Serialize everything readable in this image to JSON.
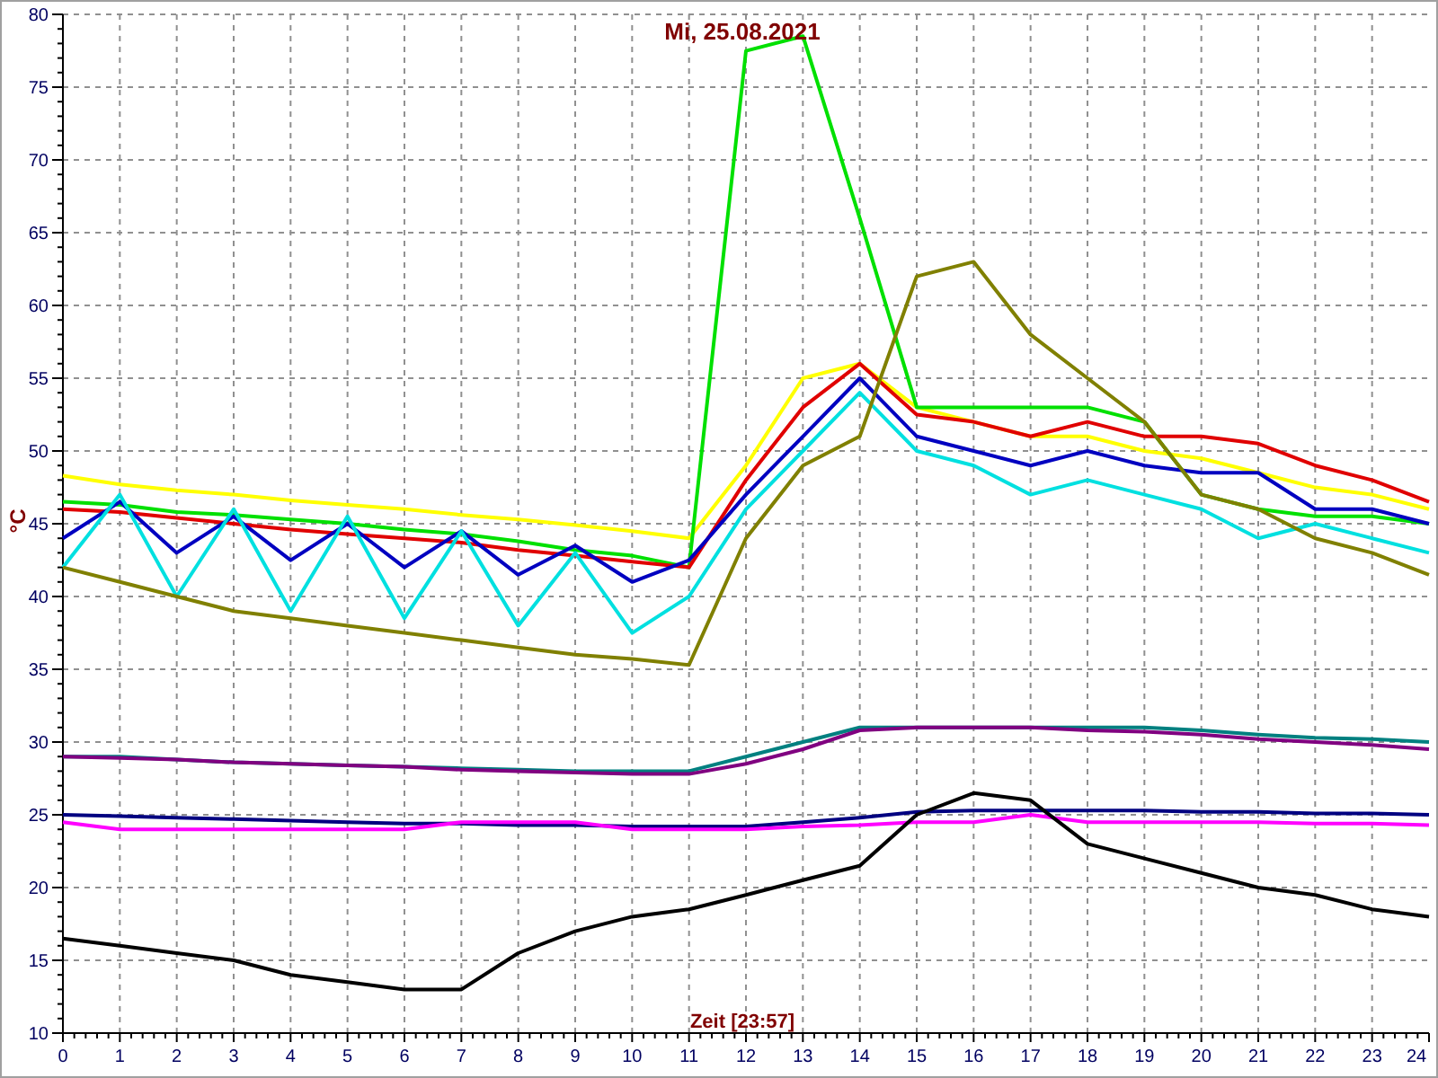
{
  "chart": {
    "chart_data": {
      "type": "line",
      "title": "Mi, 25.08.2021",
      "xlabel": "Zeit [23:57]",
      "ylabel": "°C",
      "x": [
        0,
        1,
        2,
        3,
        4,
        5,
        6,
        7,
        8,
        9,
        10,
        11,
        12,
        13,
        14,
        15,
        16,
        17,
        18,
        19,
        20,
        21,
        22,
        23,
        24
      ],
      "grid": true,
      "xlim": [
        0,
        24
      ],
      "ylim": [
        10,
        80
      ],
      "xticks": [
        0,
        1,
        2,
        3,
        4,
        5,
        6,
        7,
        8,
        9,
        10,
        11,
        12,
        13,
        14,
        15,
        16,
        17,
        18,
        19,
        20,
        21,
        22,
        23,
        24
      ],
      "yticks": [
        10,
        15,
        20,
        25,
        30,
        35,
        40,
        45,
        50,
        55,
        60,
        65,
        70,
        75,
        80
      ],
      "series": [
        {
          "color": "#ffff00",
          "values": [
            48.3,
            47.7,
            47.3,
            47,
            46.6,
            46.3,
            46,
            45.6,
            45.3,
            44.9,
            44.5,
            44,
            49,
            55,
            56,
            53,
            52,
            51,
            51,
            50,
            49.5,
            48.5,
            47.5,
            47,
            46
          ]
        },
        {
          "color": "#00e000",
          "values": [
            46.5,
            46.3,
            45.8,
            45.6,
            45.3,
            45,
            44.6,
            44.3,
            43.8,
            43.2,
            42.8,
            42,
            77.5,
            78.5,
            66,
            53,
            53,
            53,
            53,
            52,
            47,
            46,
            45.5,
            45.5,
            45
          ]
        },
        {
          "color": "#e00000",
          "values": [
            46,
            45.8,
            45.4,
            45,
            44.6,
            44.3,
            44,
            43.7,
            43.2,
            42.8,
            42.4,
            42,
            48,
            53,
            56,
            52.5,
            52,
            51,
            52,
            51,
            51,
            50.5,
            49,
            48,
            46.5
          ]
        },
        {
          "color": "#0000c0",
          "values": [
            44,
            46.5,
            43,
            45.5,
            42.5,
            45,
            42,
            44.5,
            41.5,
            43.5,
            41,
            42.5,
            47,
            51,
            55,
            51,
            50,
            49,
            50,
            49,
            48.5,
            48.5,
            46,
            46,
            45
          ]
        },
        {
          "color": "#00e0e0",
          "values": [
            42,
            47,
            40,
            46,
            39,
            45.5,
            38.5,
            44.5,
            38,
            43,
            37.5,
            40,
            46,
            50,
            54,
            50,
            49,
            47,
            48,
            47,
            46,
            44,
            45,
            44,
            43
          ]
        },
        {
          "color": "#808000",
          "values": [
            42,
            41,
            40,
            39,
            38.5,
            38,
            37.5,
            37,
            36.5,
            36,
            35.7,
            35.3,
            44,
            49,
            51,
            62,
            63,
            58,
            55,
            52,
            47,
            46,
            44,
            43,
            41.5
          ]
        },
        {
          "color": "#008080",
          "values": [
            29,
            29,
            28.8,
            28.6,
            28.5,
            28.4,
            28.3,
            28.2,
            28.1,
            28,
            28,
            28,
            29,
            30,
            31,
            31,
            31,
            31,
            31,
            31,
            30.8,
            30.5,
            30.3,
            30.2,
            30
          ]
        },
        {
          "color": "#800080",
          "values": [
            29,
            28.9,
            28.8,
            28.6,
            28.5,
            28.4,
            28.3,
            28.1,
            28,
            27.9,
            27.8,
            27.8,
            28.5,
            29.5,
            30.8,
            31,
            31,
            31,
            30.8,
            30.7,
            30.5,
            30.2,
            30,
            29.8,
            29.5
          ]
        },
        {
          "color": "#000080",
          "values": [
            25,
            24.9,
            24.8,
            24.7,
            24.6,
            24.5,
            24.4,
            24.4,
            24.3,
            24.3,
            24.2,
            24.2,
            24.2,
            24.5,
            24.8,
            25.2,
            25.3,
            25.3,
            25.3,
            25.3,
            25.2,
            25.2,
            25.1,
            25.1,
            25
          ]
        },
        {
          "color": "#ff00ff",
          "values": [
            24.5,
            24,
            24,
            24,
            24,
            24,
            24,
            24.5,
            24.5,
            24.5,
            24,
            24,
            24,
            24.2,
            24.3,
            24.5,
            24.5,
            25,
            24.5,
            24.5,
            24.5,
            24.5,
            24.4,
            24.4,
            24.3
          ]
        },
        {
          "color": "#000000",
          "values": [
            16.5,
            16,
            15.5,
            15,
            14,
            13.5,
            13,
            13,
            15.5,
            17,
            18,
            18.5,
            19.5,
            20.5,
            21.5,
            25,
            26.5,
            26,
            23,
            22,
            21,
            20,
            19.5,
            18.5,
            18
          ]
        }
      ]
    }
  }
}
